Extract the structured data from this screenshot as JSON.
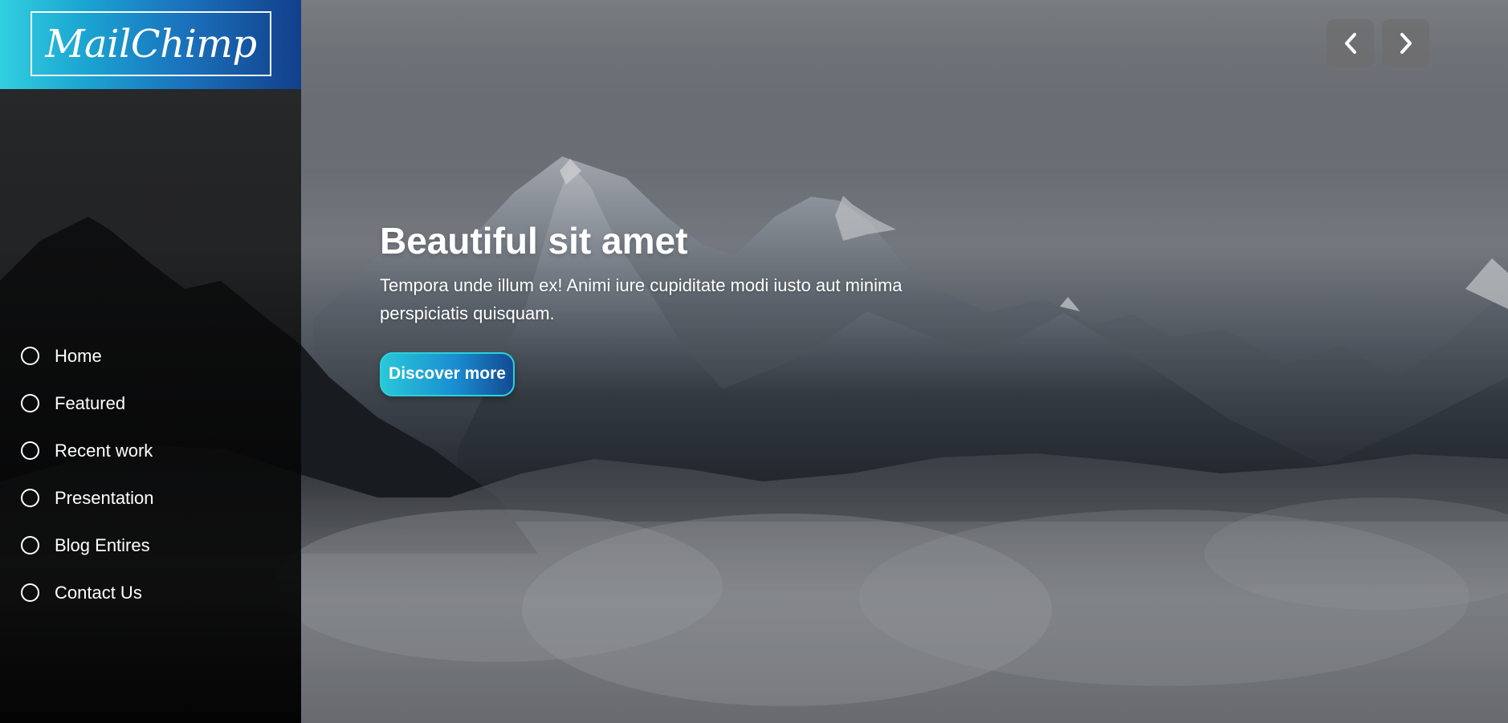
{
  "brand": {
    "logo_text": "MailChimp"
  },
  "sidebar": {
    "items": [
      {
        "label": "Home"
      },
      {
        "label": "Featured"
      },
      {
        "label": "Recent work"
      },
      {
        "label": "Presentation"
      },
      {
        "label": "Blog Entires"
      },
      {
        "label": "Contact Us"
      }
    ]
  },
  "hero": {
    "title": "Beautiful sit amet",
    "subtitle": "Tempora unde illum ex! Animi iure cupiditate modi iusto aut minima perspiciatis quisquam.",
    "cta_label": "Discover more"
  },
  "slider": {
    "prev_icon": "chevron-left-icon",
    "next_icon": "chevron-right-icon"
  },
  "colors": {
    "accent_start": "#31cfe0",
    "accent_end": "#123f8b",
    "button_border": "#2ad1dd"
  }
}
